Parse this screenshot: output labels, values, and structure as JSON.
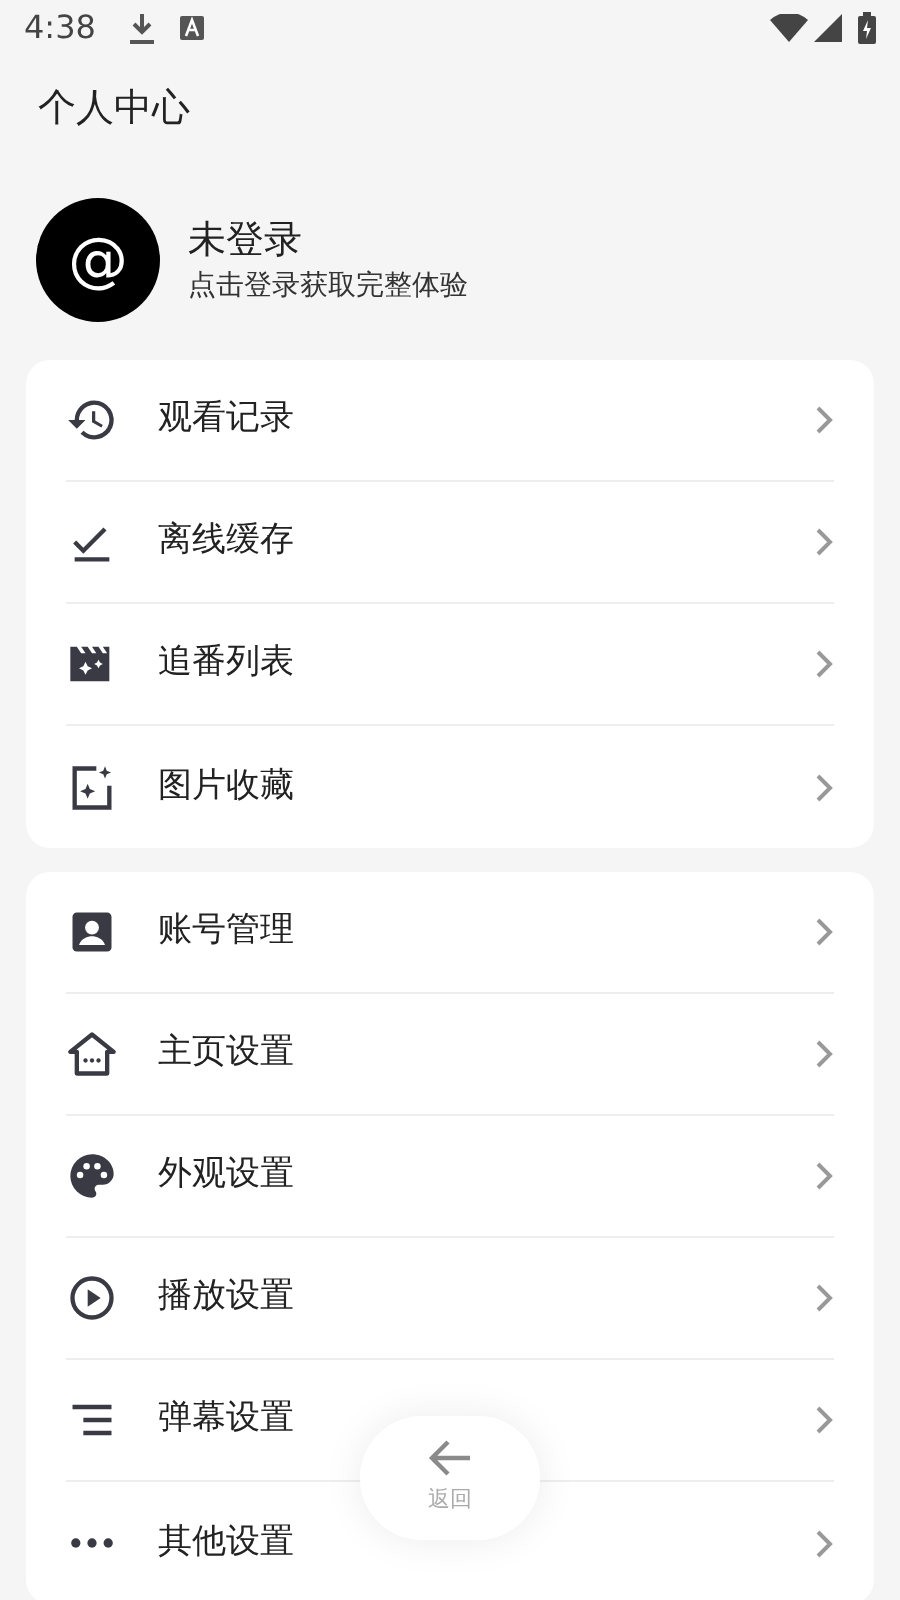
{
  "status_bar": {
    "time": "4:38"
  },
  "header": {
    "title": "个人中心"
  },
  "profile": {
    "avatar_symbol": "@",
    "name": "未登录",
    "hint": "点击登录获取完整体验"
  },
  "sections": [
    {
      "items": [
        {
          "label": "观看记录"
        },
        {
          "label": "离线缓存"
        },
        {
          "label": "追番列表"
        },
        {
          "label": "图片收藏"
        }
      ]
    },
    {
      "items": [
        {
          "label": "账号管理"
        },
        {
          "label": "主页设置"
        },
        {
          "label": "外观设置"
        },
        {
          "label": "播放设置"
        },
        {
          "label": "弹幕设置"
        },
        {
          "label": "其他设置"
        }
      ]
    }
  ],
  "back_button": {
    "label": "返回"
  }
}
